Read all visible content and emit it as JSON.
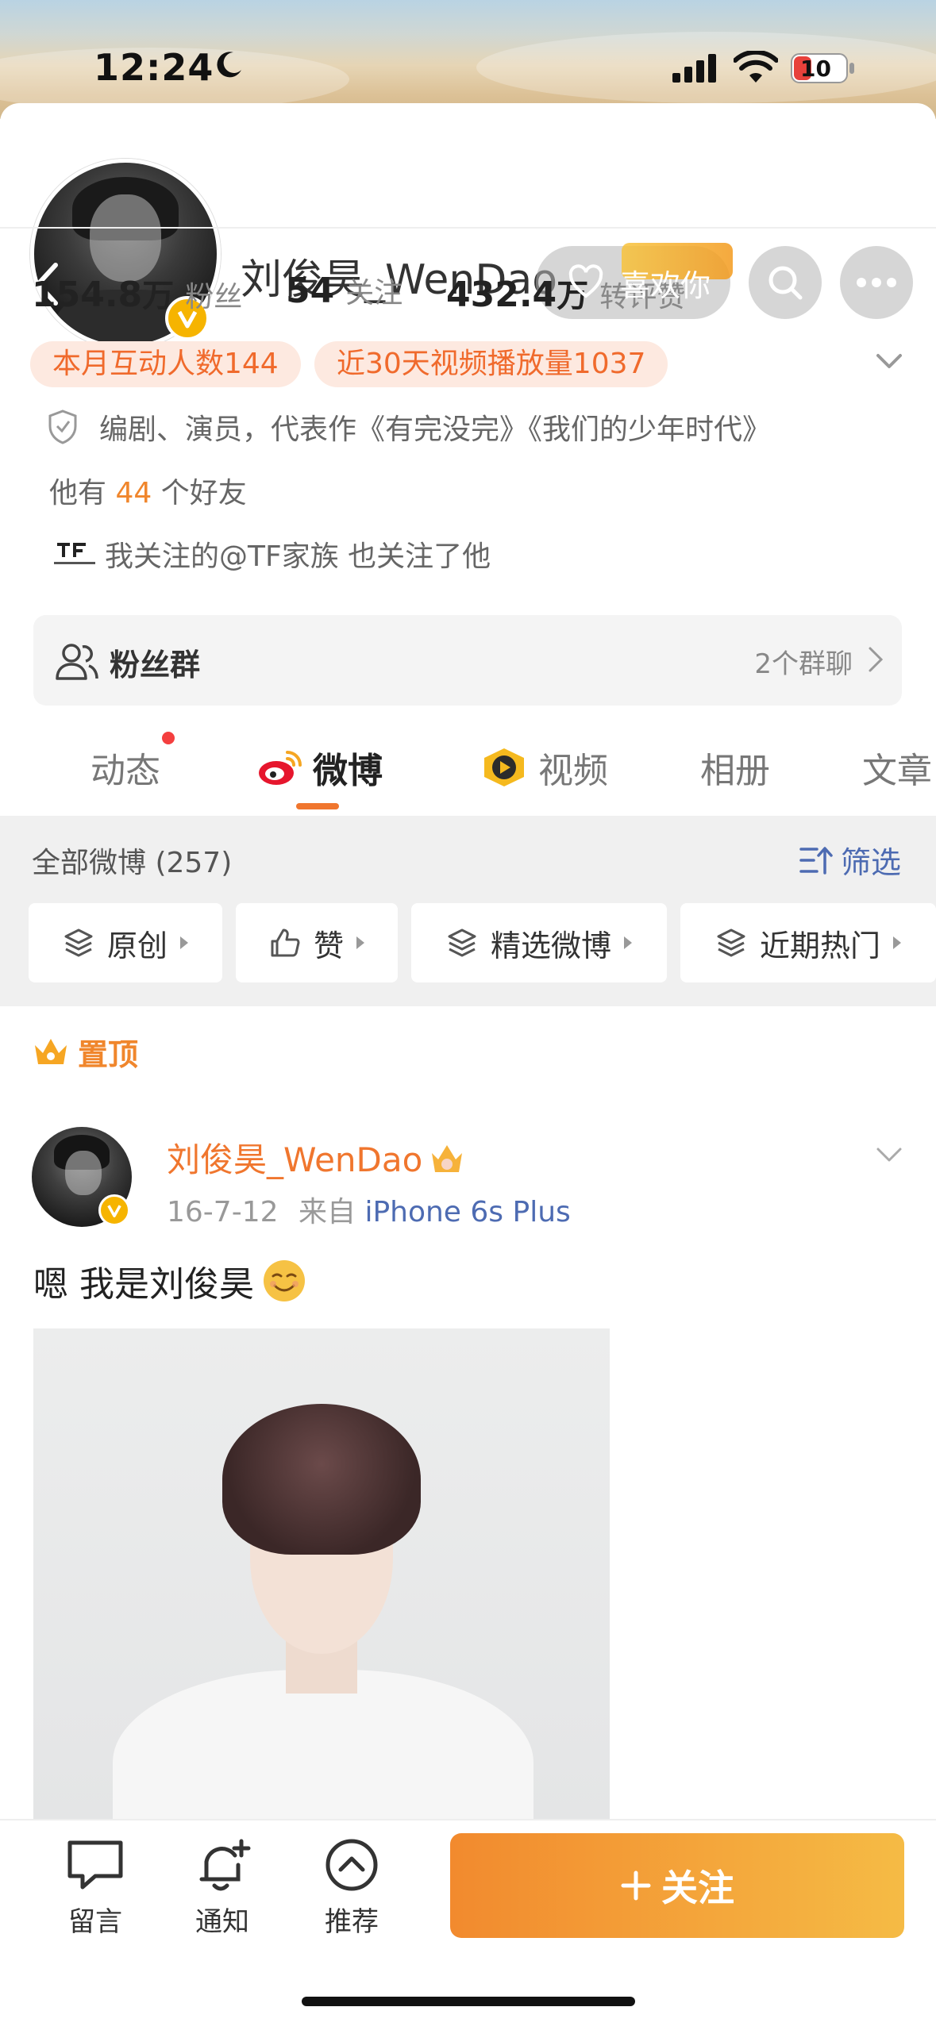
{
  "status_bar": {
    "time": "12:24",
    "battery": "10"
  },
  "profile": {
    "name": "刘俊昊_WenDao",
    "like_button": "喜欢你",
    "stats": [
      {
        "value": "154.8",
        "unit": "万",
        "label": "粉丝"
      },
      {
        "value": "54",
        "unit": "",
        "label": "关注"
      },
      {
        "value": "432.4",
        "unit": "万",
        "label": "转评赞"
      }
    ],
    "chips": [
      "本月互动人数144",
      "近30天视频播放量1037"
    ],
    "bio": "编剧、演员，代表作《有完没完》《我们的少年时代》",
    "friends_prefix": "他有",
    "friends_count": "44",
    "friends_suffix": "个好友",
    "mutual_text": "我关注的@TF家族 也关注了他",
    "fan_group": {
      "label": "粉丝群",
      "count": "2个群聊"
    }
  },
  "tabs": [
    "动态",
    "微博",
    "视频",
    "相册",
    "文章"
  ],
  "filter": {
    "count_label": "全部微博 (257)",
    "filter_button": "筛选",
    "chips": [
      "原创",
      "赞",
      "精选微博",
      "近期热门"
    ]
  },
  "pinned_label": "置顶",
  "post": {
    "author": "刘俊昊_WenDao",
    "date": "16-7-12",
    "from": "来自",
    "source": "iPhone 6s Plus",
    "text": "嗯 我是刘俊昊"
  },
  "bottom_bar": {
    "comment": "留言",
    "notify": "通知",
    "recommend": "推荐",
    "follow": "关注"
  },
  "colors": {
    "accent": "#f0762e",
    "link": "#4d6bb2",
    "verify": "#f6b400"
  }
}
